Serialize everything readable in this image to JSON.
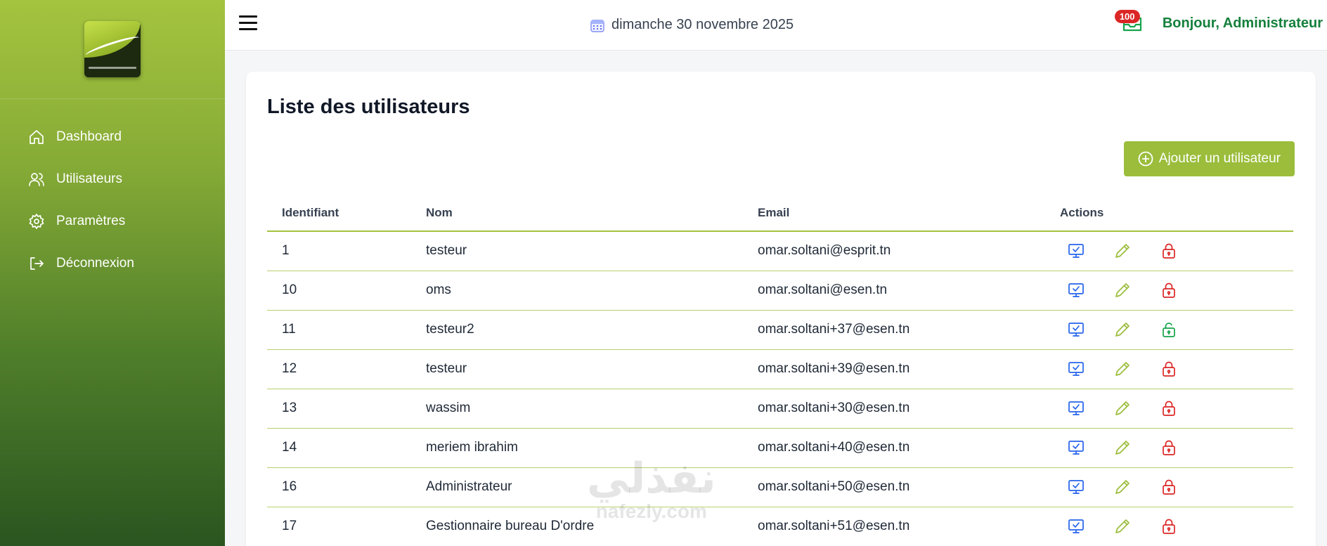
{
  "sidebar": {
    "items": [
      {
        "label": "Dashboard",
        "icon": "home-icon"
      },
      {
        "label": "Utilisateurs",
        "icon": "users-icon"
      },
      {
        "label": "Paramètres",
        "icon": "gear-icon"
      },
      {
        "label": "Déconnexion",
        "icon": "logout-icon"
      }
    ]
  },
  "header": {
    "date": "dimanche 30 novembre 2025",
    "badge_count": "100",
    "greeting": "Bonjour, Administrateur"
  },
  "main": {
    "title": "Liste des utilisateurs",
    "add_button": "Ajouter un utilisateur",
    "columns": [
      "Identifiant",
      "Nom",
      "Email",
      "Actions"
    ],
    "rows": [
      {
        "id": "1",
        "nom": "testeur",
        "email": "omar.soltani@esprit.tn",
        "locked": true
      },
      {
        "id": "10",
        "nom": "oms",
        "email": "omar.soltani@esen.tn",
        "locked": true
      },
      {
        "id": "11",
        "nom": "testeur2",
        "email": "omar.soltani+37@esen.tn",
        "locked": false
      },
      {
        "id": "12",
        "nom": "testeur",
        "email": "omar.soltani+39@esen.tn",
        "locked": true
      },
      {
        "id": "13",
        "nom": "wassim",
        "email": "omar.soltani+30@esen.tn",
        "locked": true
      },
      {
        "id": "14",
        "nom": "meriem ibrahim",
        "email": "omar.soltani+40@esen.tn",
        "locked": true
      },
      {
        "id": "16",
        "nom": "Administrateur",
        "email": "omar.soltani+50@esen.tn",
        "locked": true
      },
      {
        "id": "17",
        "nom": "Gestionnaire bureau D'ordre",
        "email": "omar.soltani+51@esen.tn",
        "locked": true
      }
    ]
  },
  "watermark": {
    "arabic": "نفذلي",
    "latin": "nafezly.com"
  },
  "colors": {
    "accent": "#9bbd3b",
    "view": "#2563eb",
    "lock": "#dc2626",
    "unlock": "#16a34a",
    "greeting": "#15803d"
  }
}
